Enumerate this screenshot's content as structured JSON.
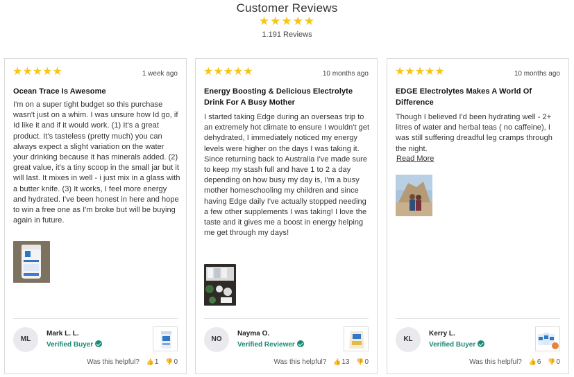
{
  "header": {
    "title": "Customer Reviews",
    "stars": "★★★★★",
    "count": "1.191 Reviews"
  },
  "reviews": [
    {
      "stars": "★★★★★",
      "date": "1 week ago",
      "title": "Ocean Trace Is Awesome",
      "body": "I'm on a super tight budget so this purchase wasn't just on a whim. I was unsure how Id go, if Id like it and if it would work. (1) It's a great product. It's tasteless (pretty much) you can always expect a slight variation on the water your drinking because it has minerals added. (2) great value, it's a tiny scoop in the small jar but it will last. It mixes in well - i just mix in a glass with a butter knife. (3) It works, I feel more energy and hydrated. I've been honest in here and hope to win a free one as I'm broke but will be buying again in future.",
      "initials": "ML",
      "name": "Mark L. L.",
      "badge": "Verified Buyer",
      "helpful_label": "Was this helpful?",
      "up": "1",
      "down": "0"
    },
    {
      "stars": "★★★★★",
      "date": "10 months ago",
      "title": "Energy Boosting & Delicious Electrolyte Drink For A Busy Mother",
      "body": "I started taking Edge during an overseas trip to an extremely hot climate to ensure I wouldn't get dehydrated, I immediately noticed my energy levels were higher on the days I was taking it. Since returning back to Australia I've made sure to keep my stash full and have 1 to 2 a day depending on how busy my day is, I'm a busy mother homeschooling my children and since having Edge daily I've actually stopped needing a few other supplements I was taking! I love the taste and it gives me a boost in energy helping me get through my days!",
      "initials": "NO",
      "name": "Nayma O.",
      "badge": "Verified Reviewer",
      "helpful_label": "Was this helpful?",
      "up": "13",
      "down": "0"
    },
    {
      "stars": "★★★★★",
      "date": "10 months ago",
      "title": "EDGE Electrolytes Makes A World Of Difference",
      "body": "Though I believed I'd been hydrating well - 2+ litres of water and herbal teas ( no caffeine), I was still suffering dreadful leg cramps through the night.",
      "read_more": "Read More",
      "initials": "KL",
      "name": "Kerry L.",
      "badge": "Verified Buyer",
      "helpful_label": "Was this helpful?",
      "up": "6",
      "down": "0"
    }
  ],
  "icons": {
    "star": "star-icon",
    "check": "check-badge-icon",
    "thumb_up": "thumbs-up-icon",
    "thumb_down": "thumbs-down-icon"
  },
  "colors": {
    "star": "#f5c518",
    "verified": "#1c8a74",
    "border": "#d9d9d9"
  }
}
